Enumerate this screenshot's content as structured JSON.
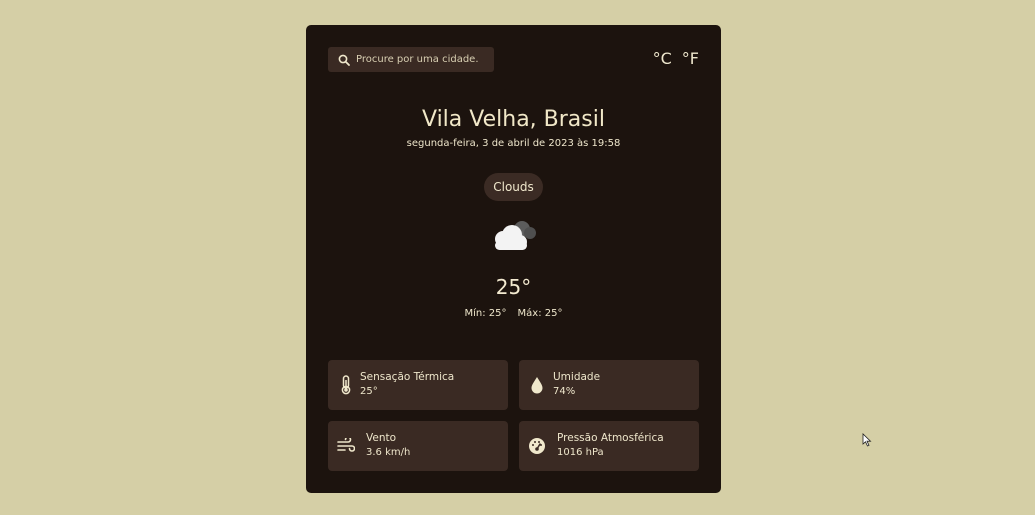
{
  "search": {
    "placeholder": "Procure por uma cidade."
  },
  "units": {
    "celsius": "°C",
    "fahrenheit": "°F"
  },
  "location": {
    "city": "Vila Velha, Brasil",
    "datetime": "segunda-feira, 3 de abril de 2023 às 19:58"
  },
  "weather": {
    "condition": "Clouds",
    "icon": "clouds-icon",
    "temperature": "25°",
    "min": "Mín: 25°",
    "max": "Máx: 25°"
  },
  "details": [
    {
      "icon": "thermometer-icon",
      "label": "Sensação Térmica",
      "value": "25°"
    },
    {
      "icon": "water-drop-icon",
      "label": "Umidade",
      "value": "74%"
    },
    {
      "icon": "wind-icon",
      "label": "Vento",
      "value": "3.6 km/h"
    },
    {
      "icon": "gauge-icon",
      "label": "Pressão Atmosférica",
      "value": "1016 hPa"
    }
  ],
  "colors": {
    "background": "#d5cfa6",
    "card": "#1c130e",
    "tile": "#3a2a23",
    "text": "#eee6cb"
  }
}
